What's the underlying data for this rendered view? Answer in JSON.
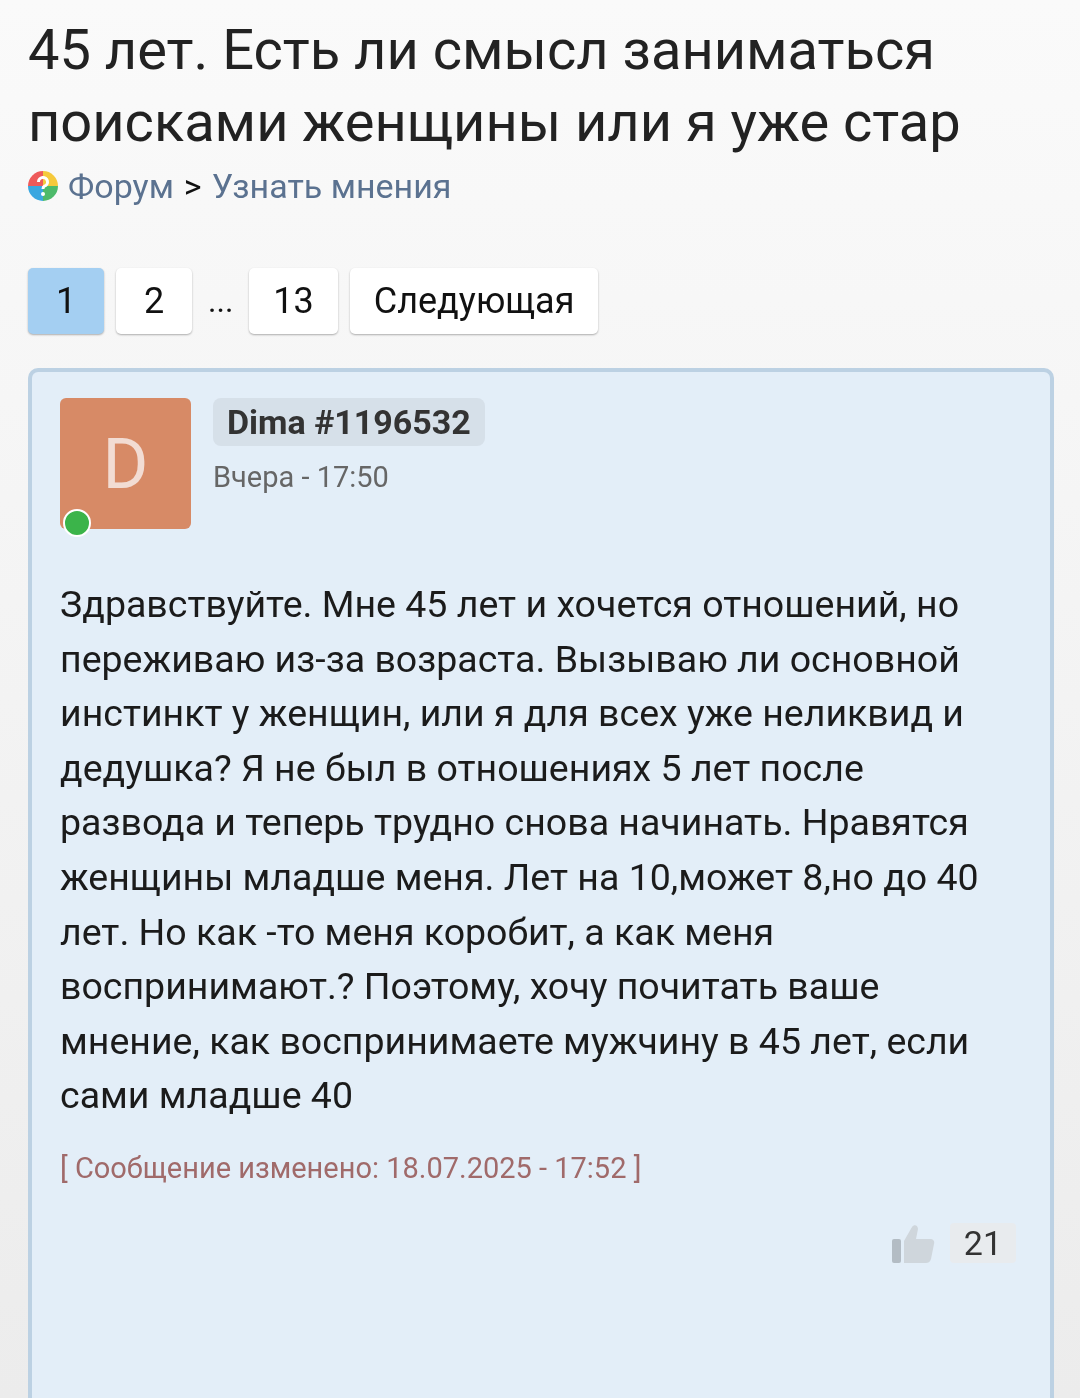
{
  "title": "45 лет. Есть ли смысл заниматься поисками женщины или я уже стар",
  "breadcrumb": [
    {
      "label": "Форум"
    },
    {
      "label": ">"
    },
    {
      "label": "Узнать мнения"
    }
  ],
  "pagination": [
    {
      "kind": "page",
      "label": "1",
      "selected": true
    },
    {
      "kind": "page",
      "label": "2",
      "selected": false
    },
    {
      "kind": "ellipsis",
      "label": "..."
    },
    {
      "kind": "page",
      "label": "13",
      "selected": false
    },
    {
      "kind": "next",
      "label": "Следующая"
    }
  ],
  "post": {
    "avatar_letter": "D",
    "online": true,
    "author": "Dima #1196532",
    "time": "Вчера - 17:50",
    "text": "Здравствуйте. Мне 45 лет и хочется отношений, но переживаю из-за возраста. Вызываю ли основной инстинкт у женщин, или я для всех уже неликвид и дедушка? Я не был в отношениях 5 лет после развода и теперь трудно снова начинать. Нравятся женщины младше меня. Лет на 10,может 8,но до 40 лет. Но как -то меня коробит, а как меня воспринимают.? Поэтому, хочу почитать ваше мнение, как воспринимаете мужчину в 45 лет, если сами младше 40",
    "edited": "[ Сообщение изменено: 18.07.2025 - 17:52 ]",
    "likes": "21"
  }
}
